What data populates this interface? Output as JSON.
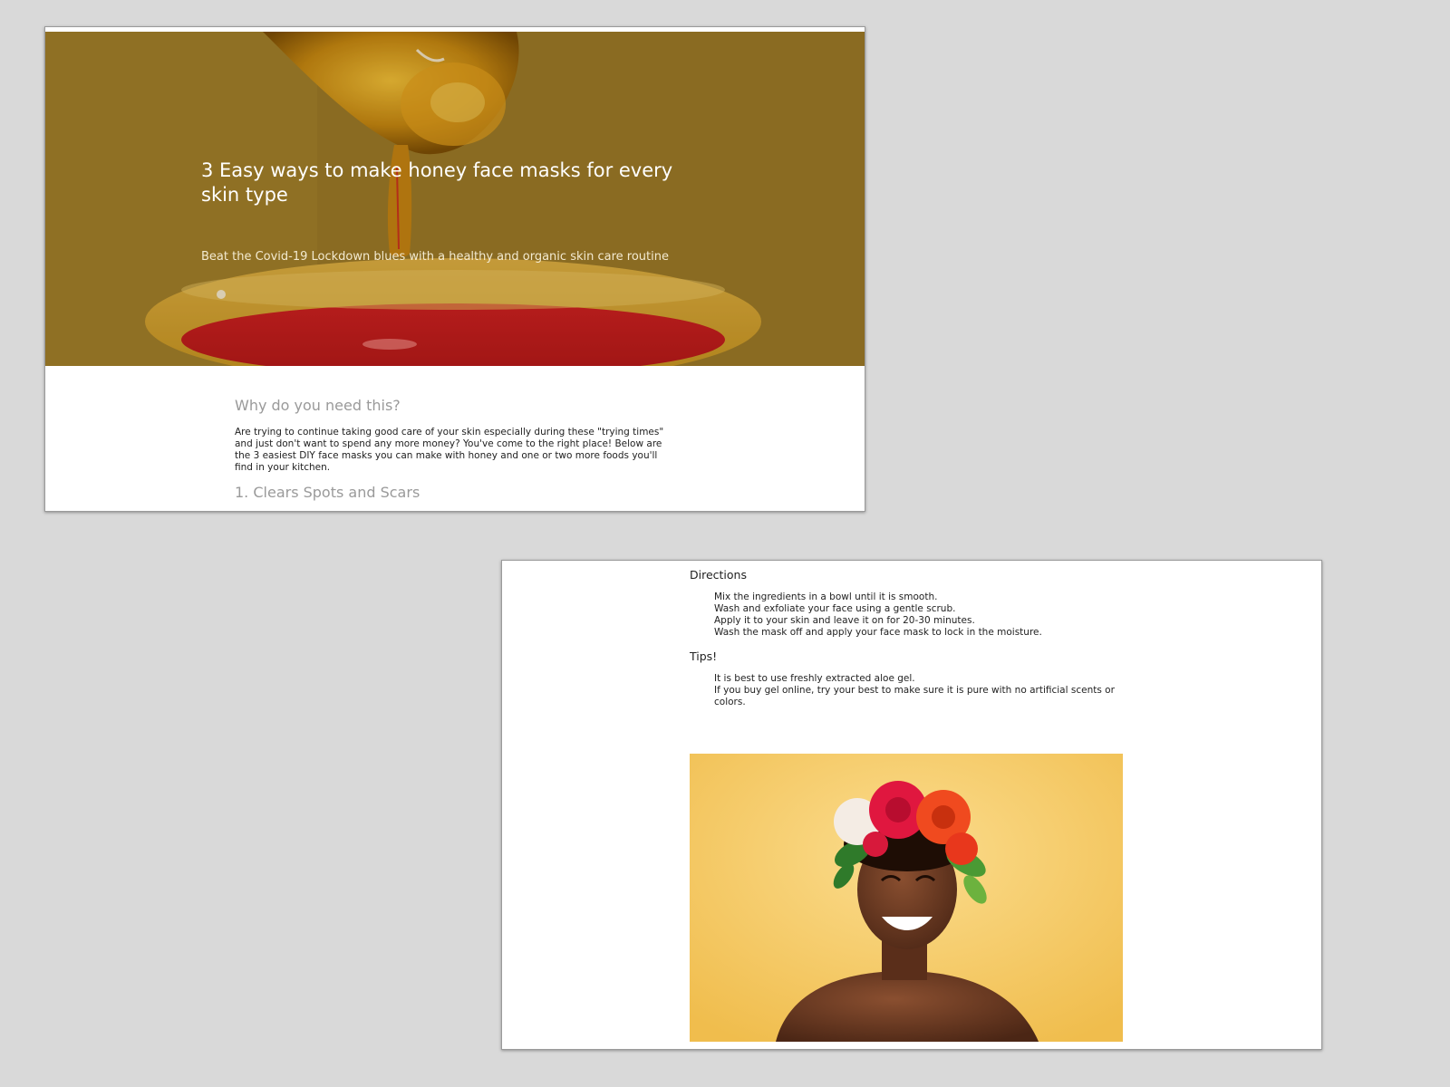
{
  "article": {
    "title": "3 Easy ways to make honey face masks for every skin type",
    "subtitle": "Beat the Covid-19 Lockdown blues with a healthy and organic skin care routine",
    "why_heading": "Why do you need this?",
    "intro": "Are trying to continue taking good care of your skin especially during these \"trying times\" and just don't want to spend any more money? You've come to the right place! Below are the 3 easiest DIY face masks you can make with honey and one or two more foods you'll find in your kitchen.",
    "first_method_heading": "1. Clears Spots and Scars"
  },
  "directions": {
    "label": "Directions",
    "steps": [
      "Mix the ingredients in a bowl until it is smooth.",
      "Wash and exfoliate your face using a gentle scrub.",
      "Apply it to your skin and leave it on for 20-30 minutes.",
      "Wash the mask off and apply your face mask to lock in the moisture."
    ]
  },
  "tips": {
    "label": "Tips!",
    "items": [
      "It is best to use freshly extracted aloe gel.",
      "If you buy gel online, try your best to make sure it is pure with no artificial scents or colors."
    ]
  },
  "images": {
    "hero": "honey-dripping-into-bowl",
    "photo": "smiling-woman-with-flower-crown"
  },
  "colors": {
    "canvas_background": "#d9d9d9",
    "hero_honey": "#a5802a",
    "heading_gray": "#9a9a9a",
    "body_text": "#222222",
    "photo_background": "#f4c760"
  }
}
